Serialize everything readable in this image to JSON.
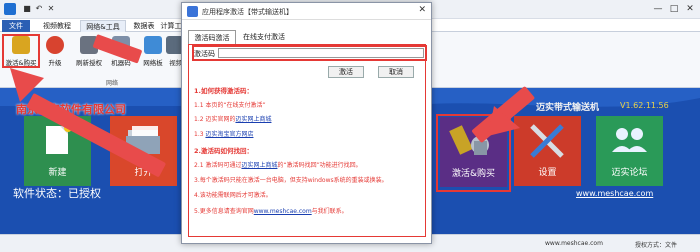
{
  "app": {
    "quick_access": [
      "save-icon",
      "undo-icon",
      "close-x-icon"
    ],
    "window_controls": [
      "—",
      "□",
      "✕"
    ]
  },
  "menu_tabs": [
    "文件",
    "视频教程",
    "网络&工具",
    "数据表",
    "计算工"
  ],
  "ribbon": {
    "buttons": [
      {
        "label": "激活&购买",
        "icon": "key-icon"
      },
      {
        "label": "升级",
        "icon": "upgrade-icon"
      },
      {
        "label": "刷新授权",
        "icon": "lock-icon"
      },
      {
        "label": "机器码",
        "icon": "computer-icon"
      },
      {
        "label": "网络板",
        "icon": "network-icon"
      },
      {
        "label": "视频教",
        "icon": "video-icon"
      }
    ],
    "group_label": "网络"
  },
  "banner": {
    "company": "南京迈实软件有限公司",
    "product": "迈实带式输送机",
    "version": "V1.62.11.56",
    "tiles": [
      {
        "label": "新建",
        "icon": "new-doc-icon"
      },
      {
        "label": "打开",
        "icon": "folder-icon"
      },
      {
        "label": "激活&购买",
        "icon": "key-lock-icon"
      },
      {
        "label": "设置",
        "icon": "tools-icon"
      },
      {
        "label": "迈实论坛",
        "icon": "forum-icon"
      }
    ],
    "license_status": "软件状态：已授权",
    "website": "www.meshcae.com"
  },
  "statusbar": {
    "url": "www.meshcae.com",
    "mode_label": "授权方式：文件"
  },
  "dialog": {
    "title": "应用程序激活【带式输送机】",
    "tabs": [
      "激活码激活",
      "在线支付激活"
    ],
    "code_label": "激活码",
    "code_value": "",
    "activate_button": "激活",
    "cancel_button": "取消",
    "instructions": [
      {
        "text": "1.如何获得激活码：",
        "heading": true
      },
      {
        "text": "1.1 本页的“在线支付激活”",
        "heading": false
      },
      {
        "pre": "1.2 迈实官网的",
        "link": "迈实网上商城",
        "post": ""
      },
      {
        "pre": "1.3 ",
        "link": "迈实淘宝官方网店",
        "post": ""
      },
      {
        "text": "2.激活码如何找回：",
        "heading": true
      },
      {
        "pre": "2.1 激活码可通过",
        "link": "迈实网上商城",
        "post": "的“激活码找回”功能进行找回。"
      },
      {
        "text": "3.每个激活码只能在激活一台电脑，但支持windows系统的重装或换装。",
        "heading": false
      },
      {
        "text": "4.该功能需联网后才可激活。",
        "heading": false
      },
      {
        "pre": "5.更多信息请查询官网",
        "link": "www.meshcae.com",
        "post": "与我们联系。"
      }
    ]
  },
  "colors": {
    "banner_blue": "#1b4fb0",
    "accent_red": "#e53935",
    "file_tab": "#2b5fb4"
  }
}
